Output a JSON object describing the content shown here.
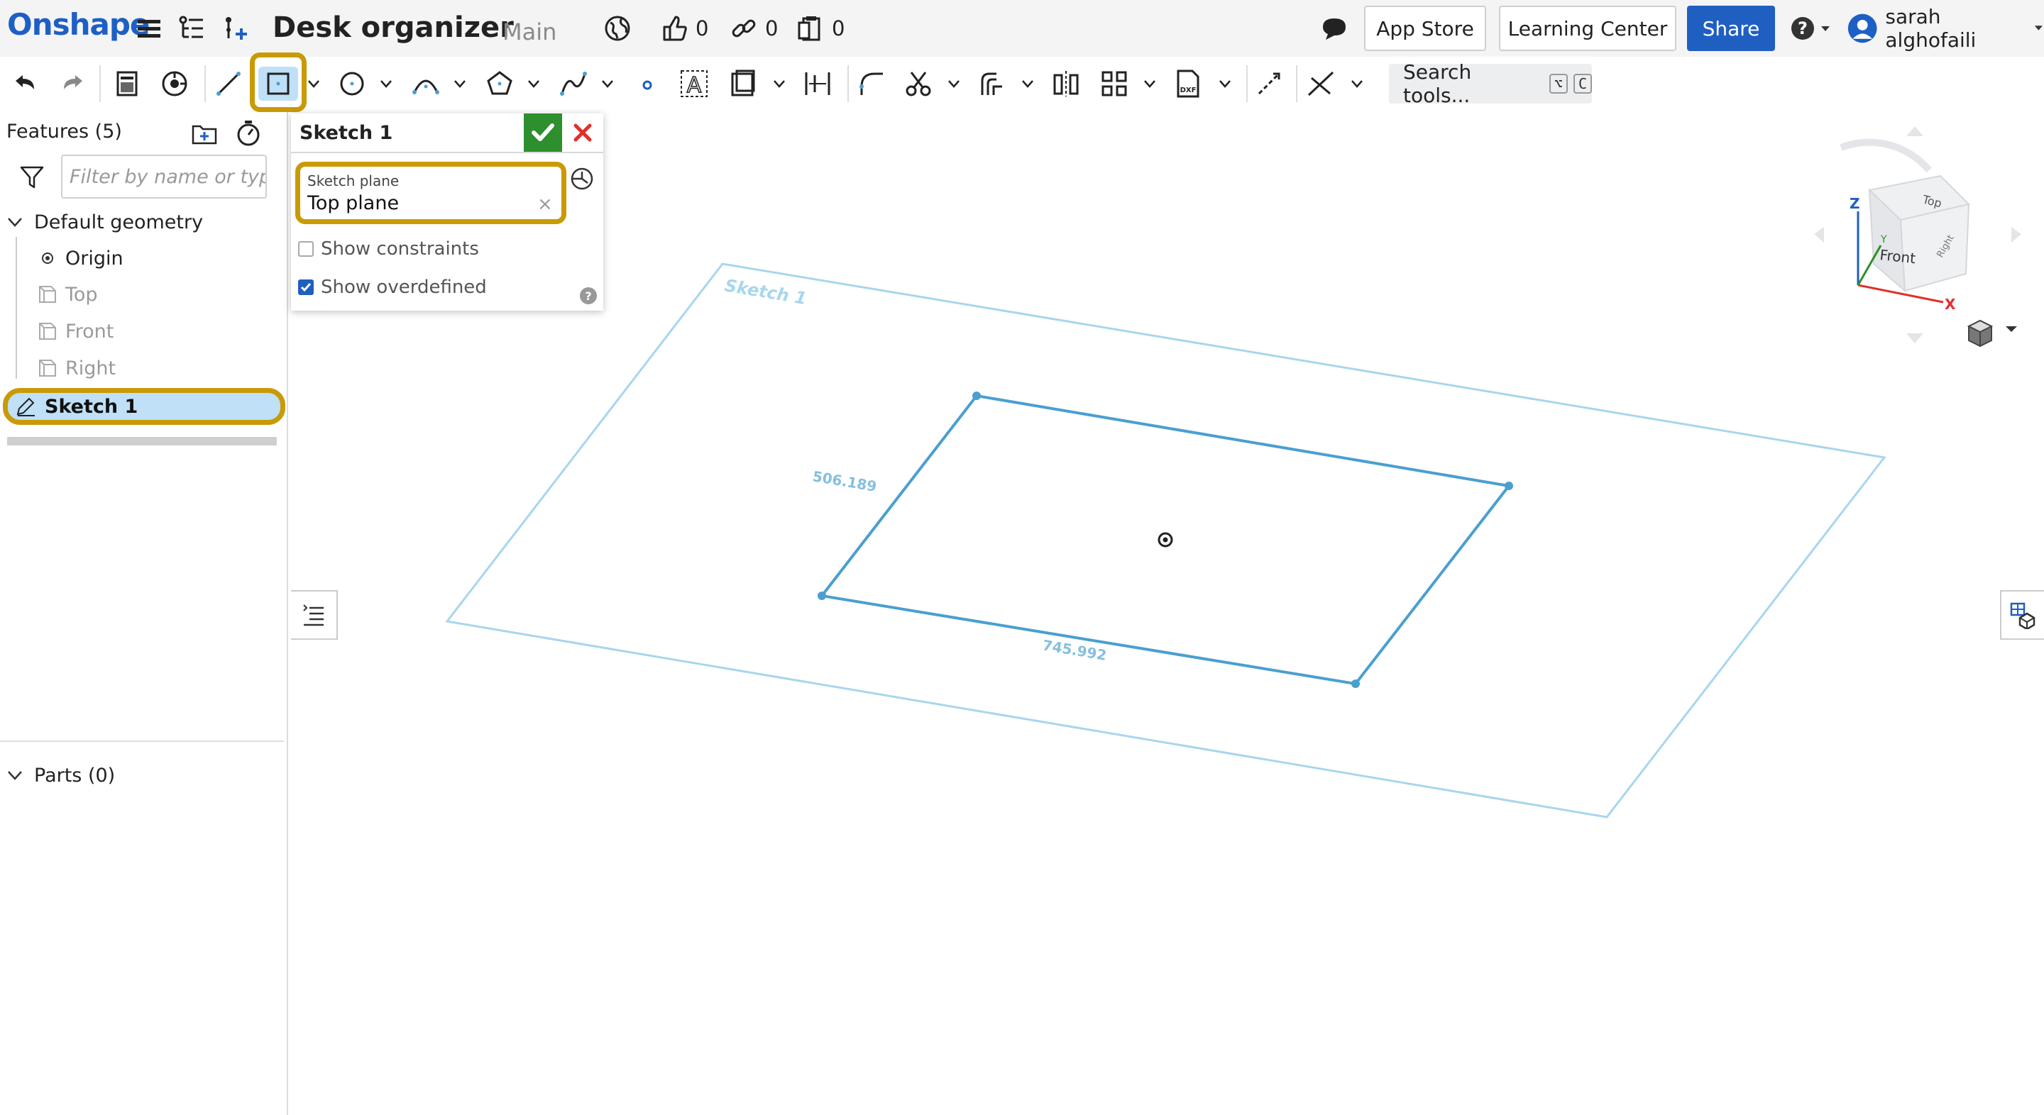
{
  "app": {
    "logo": "Onshape",
    "document_title": "Desk organizer",
    "branch": "Main",
    "likes": "0",
    "links": "0",
    "copies": "0"
  },
  "header": {
    "app_store_label": "App Store",
    "learning_center_label": "Learning Center",
    "share_label": "Share",
    "user_name": "sarah alghofaili"
  },
  "toolbar": {
    "search_label": "Search tools...",
    "search_key1": "⌥",
    "search_key2": "C"
  },
  "features": {
    "title": "Features (5)",
    "filter_placeholder": "Filter by name or type",
    "default_geometry": "Default geometry",
    "items": [
      "Origin",
      "Top",
      "Front",
      "Right"
    ],
    "sketch_item": "Sketch 1",
    "parts_title": "Parts (0)"
  },
  "sketch_dialog": {
    "title": "Sketch 1",
    "plane_label": "Sketch plane",
    "plane_value": "Top plane",
    "show_constraints": "Show constraints",
    "show_overdefined": "Show overdefined",
    "show_constraints_checked": false,
    "show_overdefined_checked": true
  },
  "viewport": {
    "plane_label": "Sketch 1",
    "dim_height": "506.189",
    "dim_width": "745.992",
    "view_cube": {
      "front": "Front",
      "top": "Top",
      "right": "Right",
      "axis_x": "X",
      "axis_y": "Y",
      "axis_z": "Z"
    }
  },
  "colors": {
    "brand": "#1d5fc4",
    "highlight": "#c99a06",
    "selection": "#bfe0f7",
    "sketch_line": "#4a9fd0",
    "plane_line": "#a8d6ee",
    "ok": "#2d8f2d",
    "cancel": "#e0302b"
  }
}
